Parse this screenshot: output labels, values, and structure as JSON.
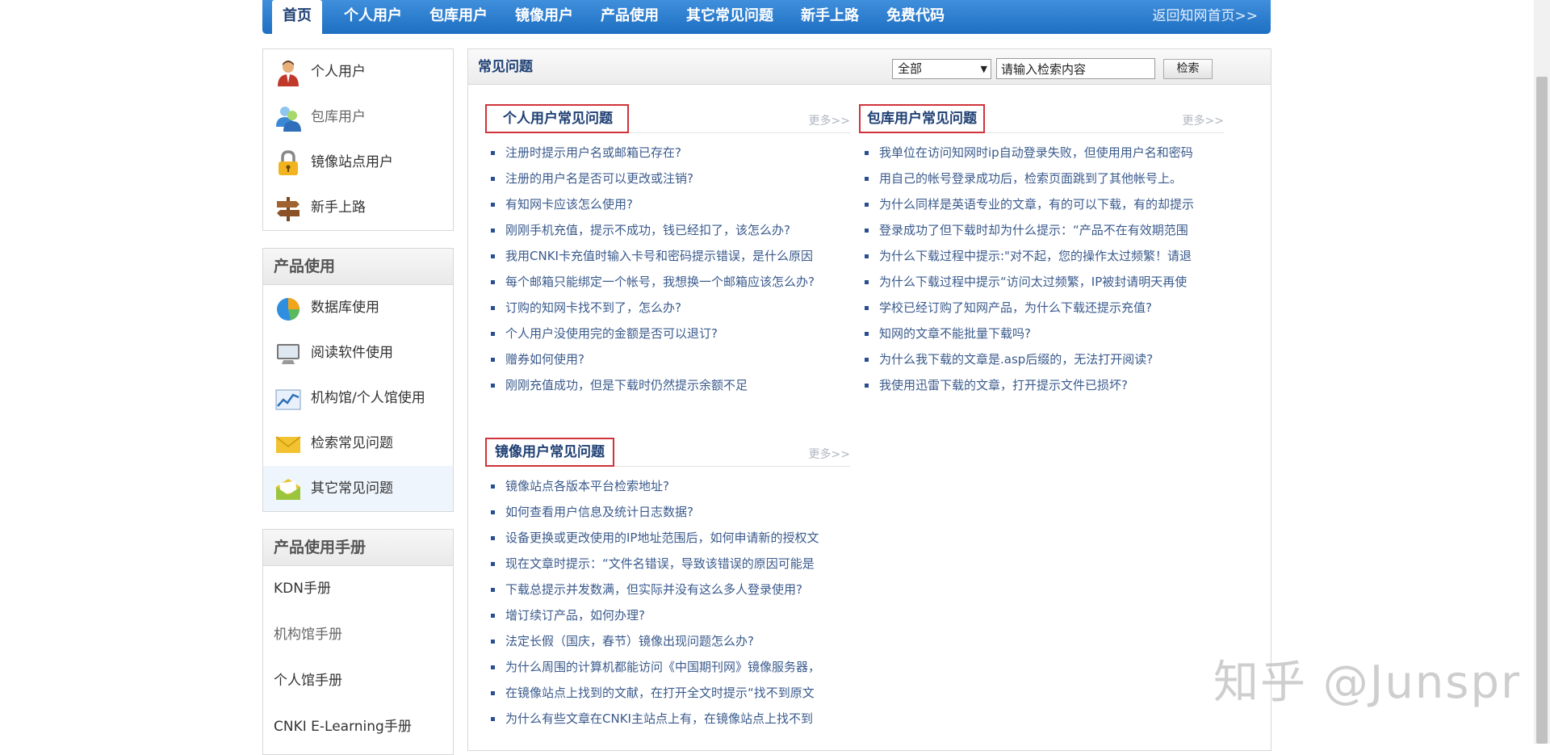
{
  "nav": {
    "tabs": [
      {
        "label": "首页"
      },
      {
        "label": "个人用户"
      },
      {
        "label": "包库用户"
      },
      {
        "label": "镜像用户"
      },
      {
        "label": "产品使用"
      },
      {
        "label": "其它常见问题"
      },
      {
        "label": "新手上路"
      },
      {
        "label": "免费代码"
      }
    ],
    "back_link": "返回知网首页>>"
  },
  "sidebar": {
    "users": [
      {
        "label": "个人用户",
        "icon": "user-icon"
      },
      {
        "label": "包库用户",
        "icon": "group-icon"
      },
      {
        "label": "镜像站点用户",
        "icon": "lock-icon"
      },
      {
        "label": "新手上路",
        "icon": "signpost-icon"
      }
    ],
    "product_usage": {
      "title": "产品使用",
      "items": [
        {
          "label": "数据库使用",
          "icon": "pie-chart-icon"
        },
        {
          "label": "阅读软件使用",
          "icon": "monitor-icon"
        },
        {
          "label": "机构馆/个人馆使用",
          "icon": "line-chart-icon"
        },
        {
          "label": "检索常见问题",
          "icon": "envelope-icon"
        },
        {
          "label": "其它常见问题",
          "icon": "open-envelope-icon"
        }
      ]
    },
    "manuals": {
      "title": "产品使用手册",
      "items": [
        {
          "label": "KDN手册"
        },
        {
          "label": "机构馆手册"
        },
        {
          "label": "个人馆手册"
        },
        {
          "label": "CNKI E-Learning手册"
        }
      ]
    }
  },
  "main": {
    "title": "常见问题",
    "filter_selected": "全部",
    "search_value": "请输入检索内容",
    "search_button": "检索",
    "more_label": "更多>>",
    "sections": {
      "personal": {
        "title": "个人用户常见问题",
        "items": [
          "注册时提示用户名或邮箱已存在?",
          "注册的用户名是否可以更改或注销?",
          "有知网卡应该怎么使用?",
          "刚刚手机充值，提示不成功，钱已经扣了，该怎么办?",
          "我用CNKI卡充值时输入卡号和密码提示错误，是什么原因",
          "每个邮箱只能绑定一个帐号，我想换一个邮箱应该怎么办?",
          "订购的知网卡找不到了，怎么办?",
          "个人用户没使用完的金额是否可以退订?",
          "赠券如何使用?",
          "刚刚充值成功，但是下载时仍然提示余额不足"
        ]
      },
      "library": {
        "title": "包库用户常见问题",
        "items": [
          "我单位在访问知网时ip自动登录失败，但使用用户名和密码",
          "用自己的帐号登录成功后，检索页面跳到了其他帐号上。",
          "为什么同样是英语专业的文章，有的可以下载，有的却提示",
          "登录成功了但下载时却为什么提示：“产品不在有效期范围",
          "为什么下载过程中提示:\"对不起，您的操作太过频繁！请退",
          "为什么下载过程中提示“访问太过频繁，IP被封请明天再使",
          "学校已经订购了知网产品，为什么下载还提示充值?",
          "知网的文章不能批量下载吗?",
          "为什么我下载的文章是.asp后缀的，无法打开阅读?",
          "我使用迅雷下载的文章，打开提示文件已损坏?"
        ]
      },
      "mirror": {
        "title": "镜像用户常见问题",
        "items": [
          "镜像站点各版本平台检索地址?",
          "如何查看用户信息及统计日志数据?",
          "设备更换或更改使用的IP地址范围后，如何申请新的授权文",
          "现在文章时提示：“文件名错误，导致该错误的原因可能是",
          "下载总提示并发数满，但实际并没有这么多人登录使用?",
          "增订续订产品，如何办理?",
          "法定长假（国庆，春节）镜像出现问题怎么办?",
          "为什么周围的计算机都能访问《中国期刊网》镜像服务器，",
          "在镜像站点上找到的文献，在打开全文时提示“找不到原文",
          "为什么有些文章在CNKI主站点上有，在镜像站点上找不到"
        ]
      }
    }
  },
  "watermark": "知乎 @Junspr"
}
